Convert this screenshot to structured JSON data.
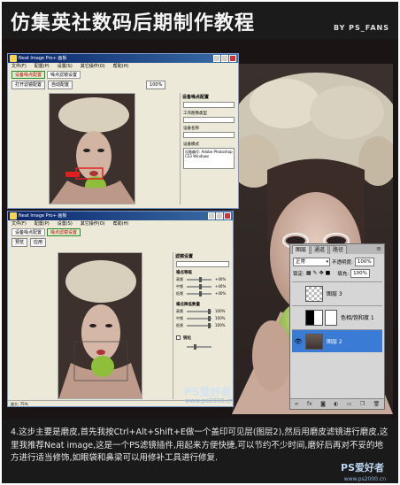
{
  "header": {
    "title": "仿集英社数码后期制作教程",
    "credit": "BY PS_FANS"
  },
  "neat_window_top": {
    "title": "Neat Image Pro+ 画板",
    "menu": [
      "文件(F)",
      "配置(P)",
      "设置(S)",
      "其它操作(O)",
      "帮助(H)"
    ],
    "tabs": [
      "设备噪点配置",
      "噪点滤镜设置"
    ],
    "toolbar": [
      "打开滤镜配置",
      "自动配置",
      "100%"
    ],
    "panel_title": "设备噪点配置",
    "panel_label1": "工作图像类型",
    "panel_label2": "设备名称",
    "panel_label3": "设备模式",
    "device_info": "设备编号: Adobe Photoshop CS3 Windows"
  },
  "neat_window_bottom": {
    "title": "Neat Image Pro+ 画板",
    "tabs": [
      "设备噪点配置",
      "噪点滤镜设置"
    ],
    "toolbar": [
      "预览",
      "应用"
    ],
    "panel_title": "滤镜设置",
    "section1": "噪点等级",
    "section2": "噪点降低数量",
    "section3": "锐化",
    "sliders": [
      {
        "label": "高频",
        "value": "+40%"
      },
      {
        "label": "中频",
        "value": "+40%"
      },
      {
        "label": "低频",
        "value": "+40%"
      },
      {
        "label": "高频",
        "value": "100%"
      },
      {
        "label": "中频",
        "value": "100%"
      },
      {
        "label": "低频",
        "value": "100%"
      }
    ],
    "status": "放大: 75%"
  },
  "layers_panel": {
    "tabs": [
      "图层",
      "通道",
      "路径"
    ],
    "blend_mode": "正常",
    "opacity_label": "不透明度:",
    "opacity_value": "100%",
    "lock_label": "锁定:",
    "fill_label": "填充:",
    "fill_value": "100%",
    "layers": [
      {
        "name": "图层 3",
        "type": "transparent",
        "selected": false,
        "visible": false
      },
      {
        "name": "色相/饱和度 1",
        "type": "adjustment",
        "selected": false,
        "visible": false
      },
      {
        "name": "图层 2",
        "type": "image",
        "selected": true,
        "visible": true
      }
    ],
    "footer_icons": [
      "link-icon",
      "fx-icon",
      "mask-icon",
      "adjustment-icon",
      "folder-icon",
      "new-layer-icon",
      "trash-icon"
    ]
  },
  "watermark": {
    "brand": "PS爱好者",
    "url": "www.ps2000.cn"
  },
  "description": {
    "text": "4.这步主要是磨皮,首先我按Ctrl+Alt+Shift+E做一个盖印可见层(图层2),然后用磨皮滤镜进行磨皮,这里我推荐Neat image,这是一个PS滤镜插件,用起来方便快捷,可以节约不少时间,磨好后再对不妥的地方进行适当修饰,如眼袋和鼻梁可以用修补工具进行修复.",
    "brand": "PS爱好者",
    "url": "www.ps2000.cn"
  },
  "colors": {
    "header_bg": "#1b1b1b",
    "panel_selection": "#3a7bd5",
    "window_title": "#0a246a",
    "apple_green": "#8fbf3a"
  }
}
